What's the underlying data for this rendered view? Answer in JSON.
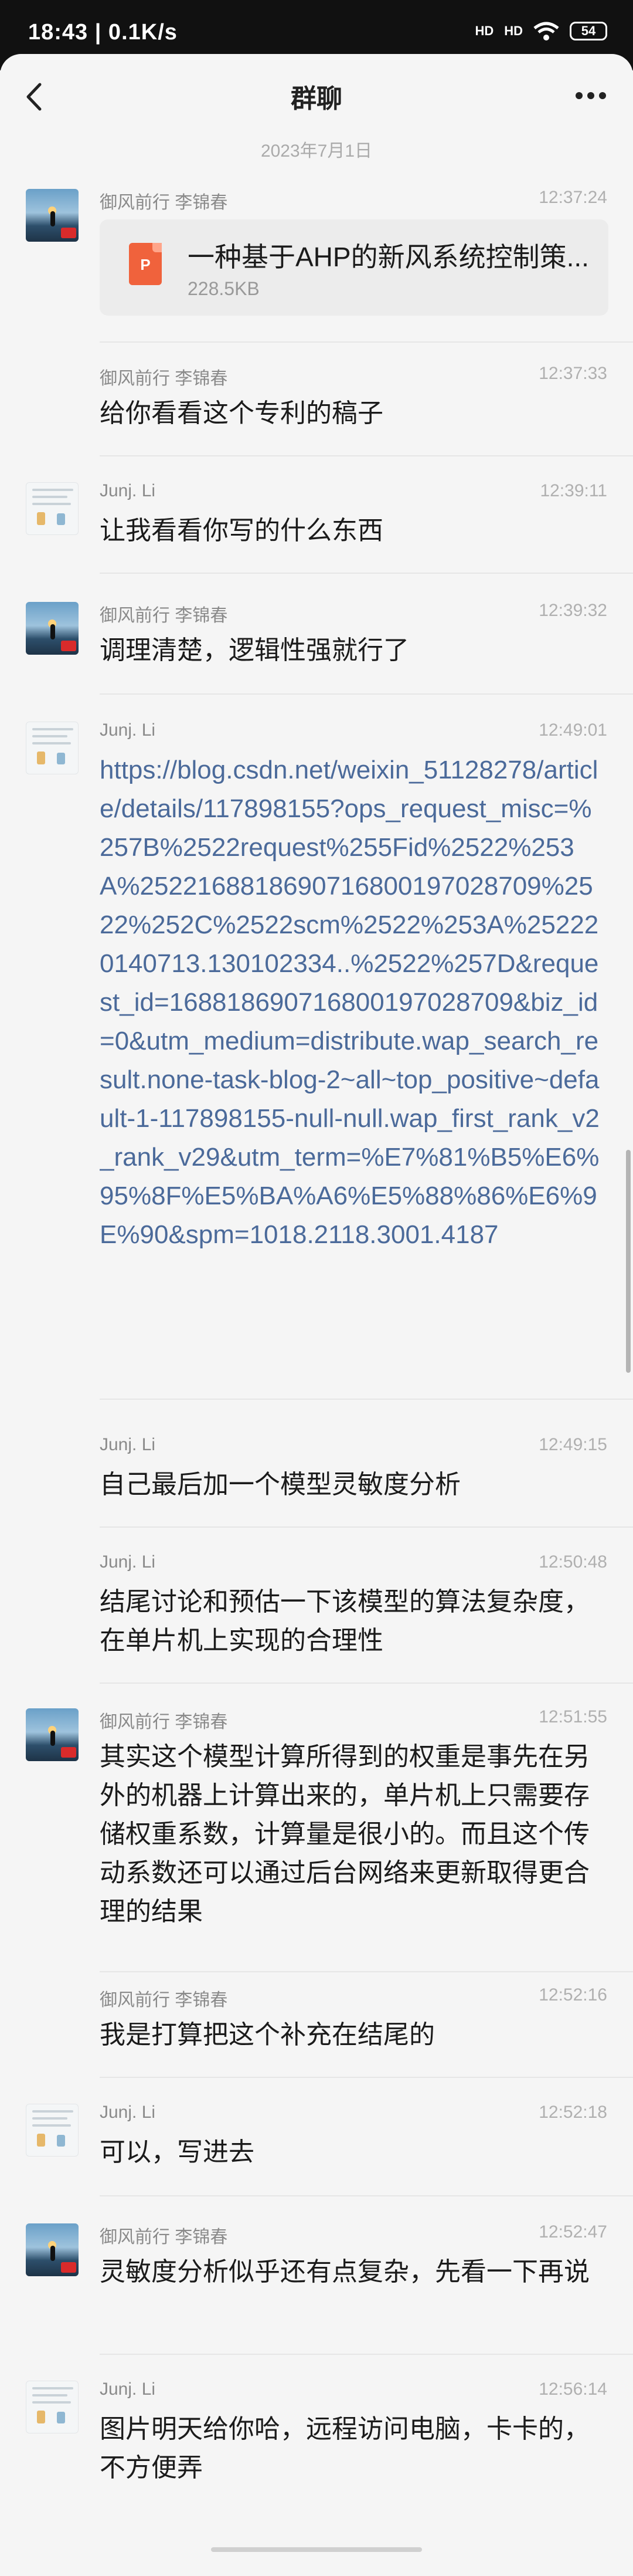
{
  "status_bar": {
    "time_speed": "18:43 | 0.1K/s",
    "signal1": "HD",
    "signal2": "HD",
    "battery": "54"
  },
  "header": {
    "title": "群聊"
  },
  "date_separator": "2023年7月1日",
  "messages": [
    {
      "sender": "御风前行 李锦春",
      "time": "12:37:24",
      "type": "file",
      "file_name": "一种基于AHP的新风系统控制策...",
      "file_size": "228.5KB",
      "file_icon_letter": "P"
    },
    {
      "sender": "御风前行 李锦春",
      "time": "12:37:33",
      "type": "text",
      "text": "给你看看这个专利的稿子"
    },
    {
      "sender": "Junj. Li",
      "time": "12:39:11",
      "type": "text",
      "text": "让我看看你写的什么东西"
    },
    {
      "sender": "御风前行 李锦春",
      "time": "12:39:32",
      "type": "text",
      "text": "调理清楚，逻辑性强就行了"
    },
    {
      "sender": "Junj. Li",
      "time": "12:49:01",
      "type": "link",
      "text": "https://blog.csdn.net/weixin_51128278/article/details/117898155?ops_request_misc=%257B%2522request%255Fid%2522%253A%2522168818690716800197028709%2522%252C%2522scm%2522%253A%252220140713.130102334..%2522%257D&request_id=168818690716800197028709&biz_id=0&utm_medium=distribute.wap_search_result.none-task-blog-2~all~top_positive~default-1-117898155-null-null.wap_first_rank_v2_rank_v29&utm_term=%E7%81%B5%E6%95%8F%E5%BA%A6%E5%88%86%E6%9E%90&spm=1018.2118.3001.4187"
    },
    {
      "sender": "Junj. Li",
      "time": "12:49:15",
      "type": "text",
      "text": "自己最后加一个模型灵敏度分析"
    },
    {
      "sender": "Junj. Li",
      "time": "12:50:48",
      "type": "text",
      "text": "结尾讨论和预估一下该模型的算法复杂度，在单片机上实现的合理性"
    },
    {
      "sender": "御风前行 李锦春",
      "time": "12:51:55",
      "type": "text",
      "text": "其实这个模型计算所得到的权重是事先在另外的机器上计算出来的，单片机上只需要存储权重系数，计算量是很小的。而且这个传动系数还可以通过后台网络来更新取得更合理的结果"
    },
    {
      "sender": "御风前行 李锦春",
      "time": "12:52:16",
      "type": "text",
      "text": "我是打算把这个补充在结尾的"
    },
    {
      "sender": "Junj. Li",
      "time": "12:52:18",
      "type": "text",
      "text": "可以，写进去"
    },
    {
      "sender": "御风前行 李锦春",
      "time": "12:52:47",
      "type": "text",
      "text": "灵敏度分析似乎还有点复杂，先看一下再说"
    },
    {
      "sender": "Junj. Li",
      "time": "12:56:14",
      "type": "text",
      "text": "图片明天给你哈，远程访问电脑，卡卡的，不方便弄"
    }
  ]
}
